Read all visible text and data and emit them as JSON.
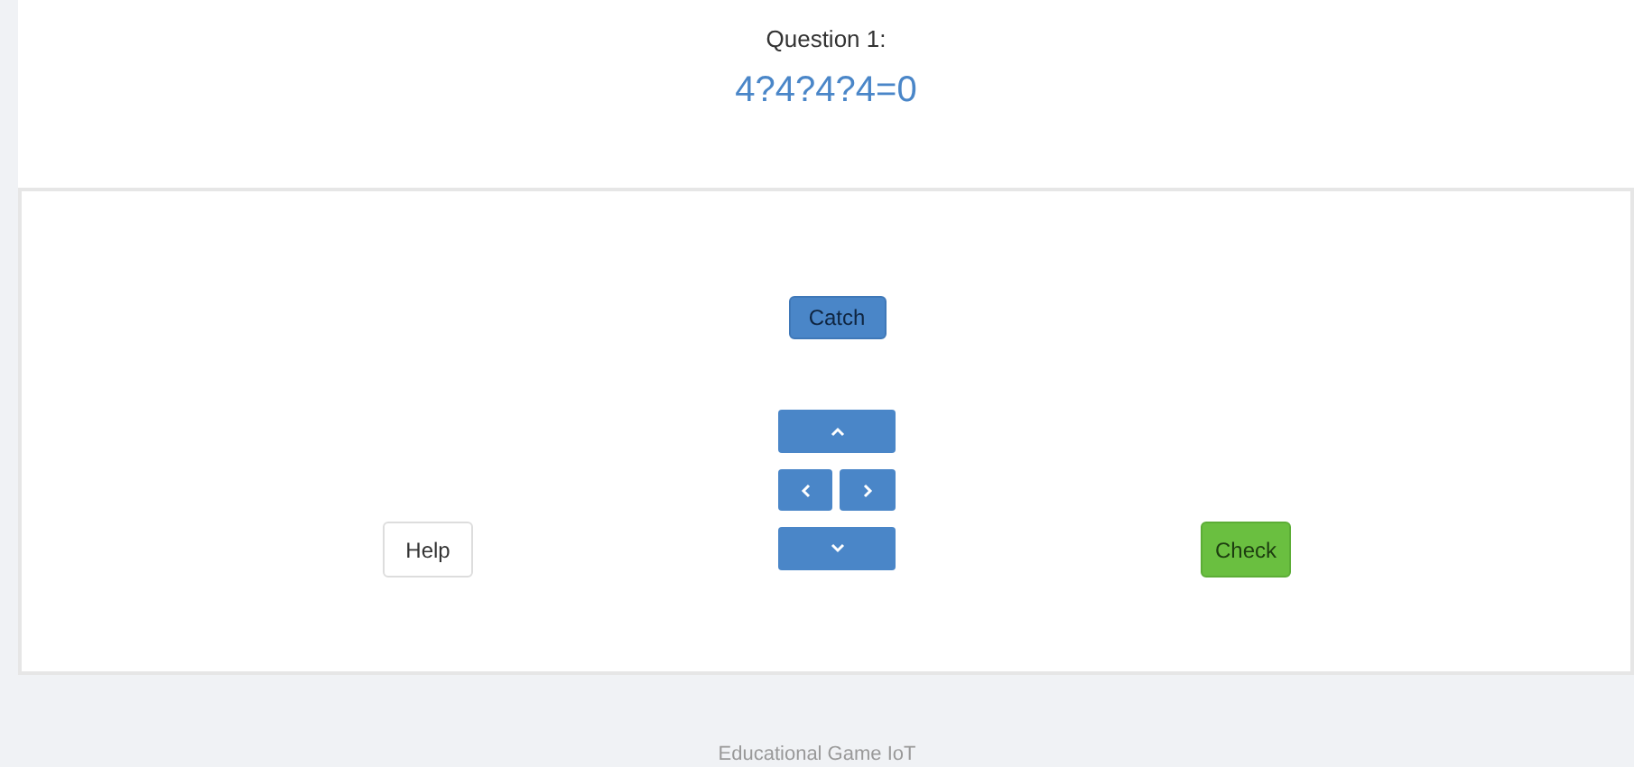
{
  "question": {
    "label": "Question 1:",
    "expression": "4?4?4?4=0"
  },
  "buttons": {
    "catch": "Catch",
    "help": "Help",
    "check": "Check"
  },
  "footer": {
    "text": "Educational Game IoT"
  }
}
